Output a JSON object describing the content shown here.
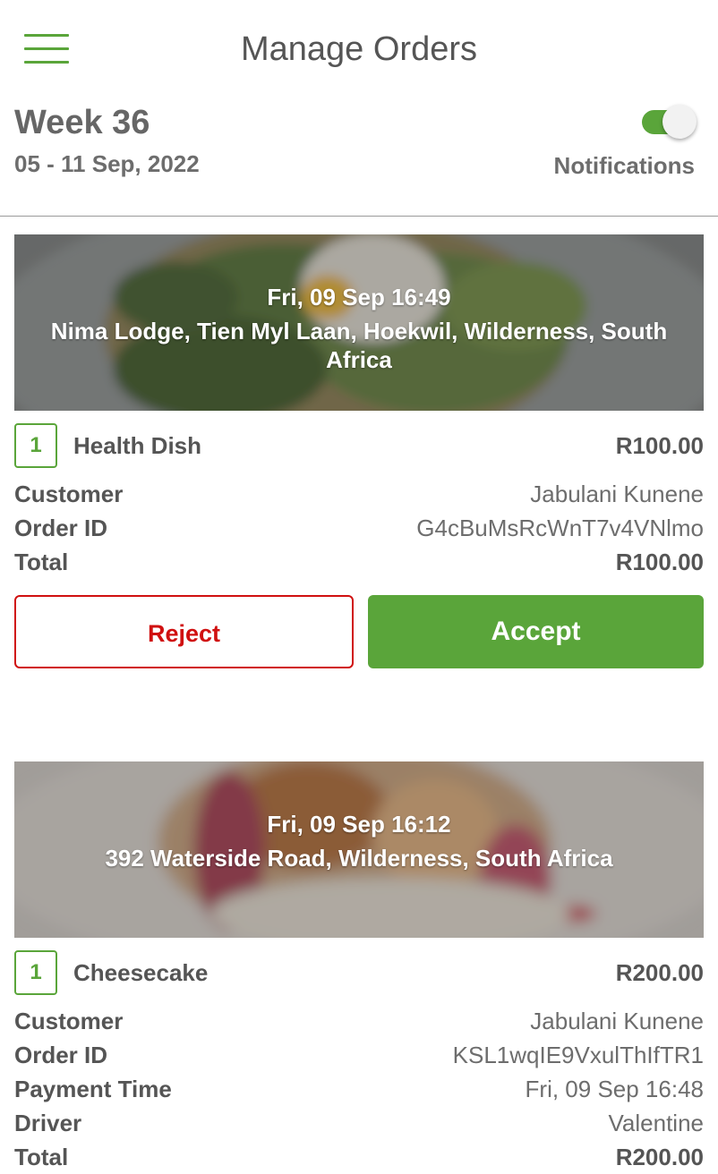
{
  "header": {
    "title": "Manage Orders"
  },
  "week": {
    "label": "Week 36",
    "range": "05 - 11 Sep, 2022"
  },
  "notifications": {
    "label": "Notifications",
    "enabled": true
  },
  "colors": {
    "accent": "#5aa53a",
    "reject": "#d01010",
    "text": "#555555"
  },
  "orders": [
    {
      "datetime": "Fri, 09 Sep 16:49",
      "address": "Nima Lodge, Tien Myl Laan, Hoekwil, Wilderness, South Africa",
      "quantity": "1",
      "item": "Health Dish",
      "price": "R100.00",
      "customer_label": "Customer",
      "customer": "Jabulani Kunene",
      "order_id_label": "Order ID",
      "order_id": "G4cBuMsRcWnT7v4VNlmo",
      "total_label": "Total",
      "total": "R100.00",
      "reject_label": "Reject",
      "accept_label": "Accept"
    },
    {
      "datetime": "Fri, 09 Sep 16:12",
      "address": "392 Waterside Road, Wilderness, South Africa",
      "quantity": "1",
      "item": "Cheesecake",
      "price": "R200.00",
      "customer_label": "Customer",
      "customer": "Jabulani Kunene",
      "order_id_label": "Order ID",
      "order_id": "KSL1wqIE9VxulThIfTR1",
      "payment_time_label": "Payment Time",
      "payment_time": "Fri, 09 Sep 16:48",
      "driver_label": "Driver",
      "driver": "Valentine",
      "total_label": "Total",
      "total": "R200.00"
    }
  ]
}
